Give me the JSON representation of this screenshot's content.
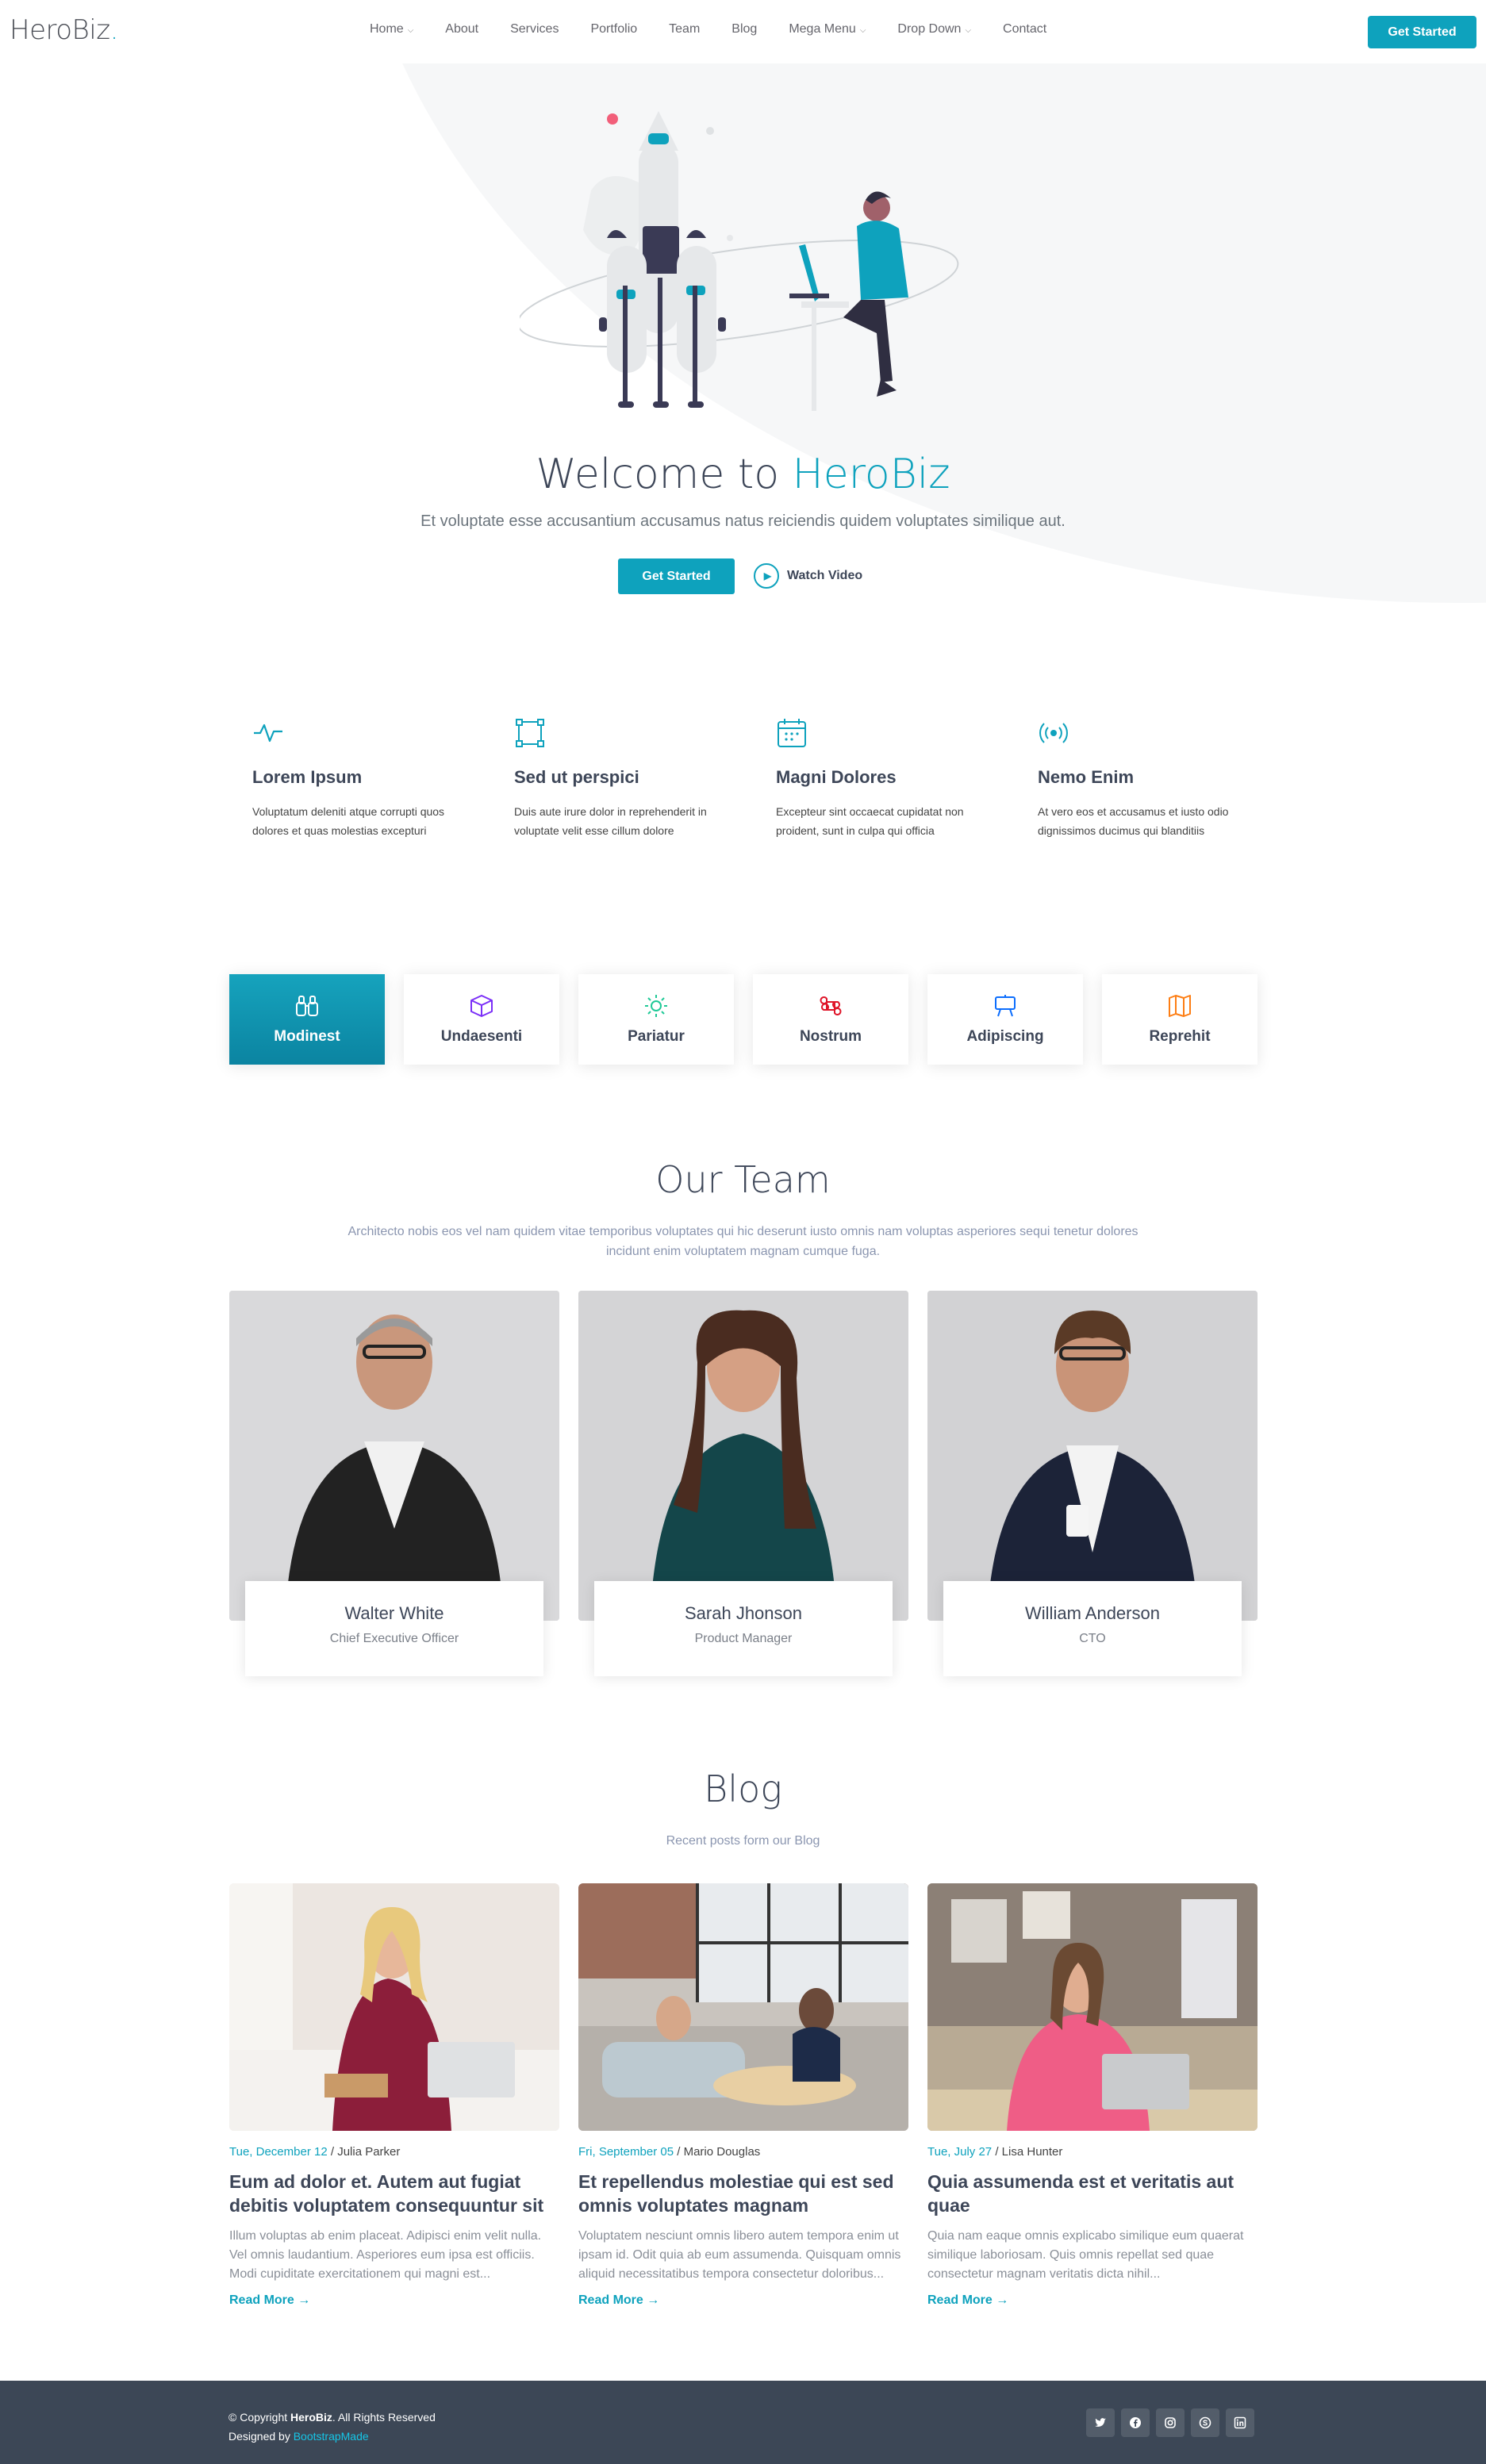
{
  "brand": {
    "name": "HeroBiz",
    "dot": ".",
    "accent": "#0ea2bd"
  },
  "nav": {
    "items": [
      {
        "label": "Home",
        "dropdown": true
      },
      {
        "label": "About",
        "dropdown": false
      },
      {
        "label": "Services",
        "dropdown": false
      },
      {
        "label": "Portfolio",
        "dropdown": false
      },
      {
        "label": "Team",
        "dropdown": false
      },
      {
        "label": "Blog",
        "dropdown": false
      },
      {
        "label": "Mega Menu",
        "dropdown": true
      },
      {
        "label": "Drop Down",
        "dropdown": true
      },
      {
        "label": "Contact",
        "dropdown": false
      }
    ],
    "cta": "Get Started"
  },
  "hero": {
    "title_prefix": "Welcome to",
    "title_accent": "HeroBiz",
    "subtitle": "Et voluptate esse accusantium accusamus natus reiciendis quidem voluptates similique aut.",
    "cta": "Get Started",
    "video": "Watch Video"
  },
  "features": [
    {
      "icon": "activity-icon",
      "title": "Lorem Ipsum",
      "text": "Voluptatum deleniti atque corrupti quos dolores et quas molestias excepturi"
    },
    {
      "icon": "bounding-box-icon",
      "title": "Sed ut perspici",
      "text": "Duis aute irure dolor in reprehenderit in voluptate velit esse cillum dolore"
    },
    {
      "icon": "calendar-icon",
      "title": "Magni Dolores",
      "text": "Excepteur sint occaecat cupidatat non proident, sunt in culpa qui officia"
    },
    {
      "icon": "broadcast-icon",
      "title": "Nemo Enim",
      "text": "At vero eos et accusamus et iusto odio dignissimos ducimus qui blanditiis"
    }
  ],
  "tabs": [
    {
      "label": "Modinest",
      "icon": "binoculars-icon",
      "color": "#ffffff",
      "active": true
    },
    {
      "label": "Undaesenti",
      "icon": "box-icon",
      "color": "#7b2ff7",
      "active": false
    },
    {
      "label": "Pariatur",
      "icon": "brightness-icon",
      "color": "#20c997",
      "active": false
    },
    {
      "label": "Nostrum",
      "icon": "command-icon",
      "color": "#df1529",
      "active": false
    },
    {
      "label": "Adipiscing",
      "icon": "easel-icon",
      "color": "#0d6efd",
      "active": false
    },
    {
      "label": "Reprehit",
      "icon": "map-icon",
      "color": "#fd7e14",
      "active": false
    }
  ],
  "team": {
    "title": "Our Team",
    "subtitle": "Architecto nobis eos vel nam quidem vitae temporibus voluptates qui hic deserunt iusto omnis nam voluptas asperiores sequi tenetur dolores incidunt enim voluptatem magnam cumque fuga.",
    "members": [
      {
        "name": "Walter White",
        "role": "Chief Executive Officer"
      },
      {
        "name": "Sarah Jhonson",
        "role": "Product Manager"
      },
      {
        "name": "William Anderson",
        "role": "CTO"
      }
    ]
  },
  "blog": {
    "title": "Blog",
    "subtitle": "Recent posts form our Blog",
    "posts": [
      {
        "date": "Tue, December 12",
        "author": "Julia Parker",
        "title": "Eum ad dolor et. Autem aut fugiat debitis voluptatem consequuntur sit",
        "excerpt": "Illum voluptas ab enim placeat. Adipisci enim velit nulla. Vel omnis laudantium. Asperiores eum ipsa est officiis. Modi cupiditate exercitationem qui magni est...",
        "more": "Read More"
      },
      {
        "date": "Fri, September 05",
        "author": "Mario Douglas",
        "title": "Et repellendus molestiae qui est sed omnis voluptates magnam",
        "excerpt": "Voluptatem nesciunt omnis libero autem tempora enim ut ipsam id. Odit quia ab eum assumenda. Quisquam omnis aliquid necessitatibus tempora consectetur doloribus...",
        "more": "Read More"
      },
      {
        "date": "Tue, July 27",
        "author": "Lisa Hunter",
        "title": "Quia assumenda est et veritatis aut quae",
        "excerpt": "Quia nam eaque omnis explicabo similique eum quaerat similique laboriosam. Quis omnis repellat sed quae consectetur magnam veritatis dicta nihil...",
        "more": "Read More"
      }
    ]
  },
  "footer": {
    "copyright_prefix": "© Copyright",
    "copyright_brand": "HeroBiz",
    "copyright_suffix": ". All Rights Reserved",
    "designed_by": "Designed by",
    "designer": "BootstrapMade",
    "socials": [
      "twitter-icon",
      "facebook-icon",
      "instagram-icon",
      "skype-icon",
      "linkedin-icon"
    ]
  }
}
